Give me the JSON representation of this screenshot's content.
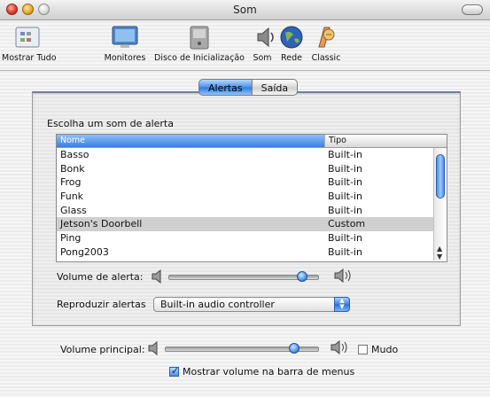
{
  "window": {
    "title": "Som"
  },
  "toolbar": {
    "items": [
      {
        "label": "Mostrar Tudo",
        "icon": "show-all-icon"
      },
      {
        "label": "Monitores",
        "icon": "monitor-icon"
      },
      {
        "label": "Disco de Inicialização",
        "icon": "startup-disk-icon"
      },
      {
        "label": "Som",
        "icon": "speaker-icon"
      },
      {
        "label": "Rede",
        "icon": "globe-icon"
      },
      {
        "label": "Classic",
        "icon": "classic-icon"
      }
    ]
  },
  "tabs": [
    {
      "label": "Alertas",
      "active": true
    },
    {
      "label": "Saída",
      "active": false
    }
  ],
  "alerts": {
    "prompt": "Escolha um som de alerta",
    "columns": [
      "Nome",
      "Tipo"
    ],
    "rows": [
      {
        "name": "Basso",
        "type": "Built-in"
      },
      {
        "name": "Bonk",
        "type": "Built-in"
      },
      {
        "name": "Frog",
        "type": "Built-in"
      },
      {
        "name": "Funk",
        "type": "Built-in"
      },
      {
        "name": "Glass",
        "type": "Built-in"
      },
      {
        "name": "Jetson's Doorbell",
        "type": "Custom"
      },
      {
        "name": "Ping",
        "type": "Built-in"
      },
      {
        "name": "Pong2003",
        "type": "Built-in"
      }
    ],
    "selected": "Jetson's Doorbell",
    "volume_label": "Volume de alerta:",
    "volume_level": 0.9,
    "play_label": "Reproduzir alertas",
    "device_value": "Built-in audio controller"
  },
  "main": {
    "volume_label": "Volume principal:",
    "volume_level": 0.85,
    "mute_label": "Mudo",
    "mute_checked": false,
    "menubar_label": "Mostrar volume na barra de menus",
    "menubar_checked": true
  },
  "colors": {
    "accent": "#3a7fda",
    "selection": "#d0d0d0"
  }
}
